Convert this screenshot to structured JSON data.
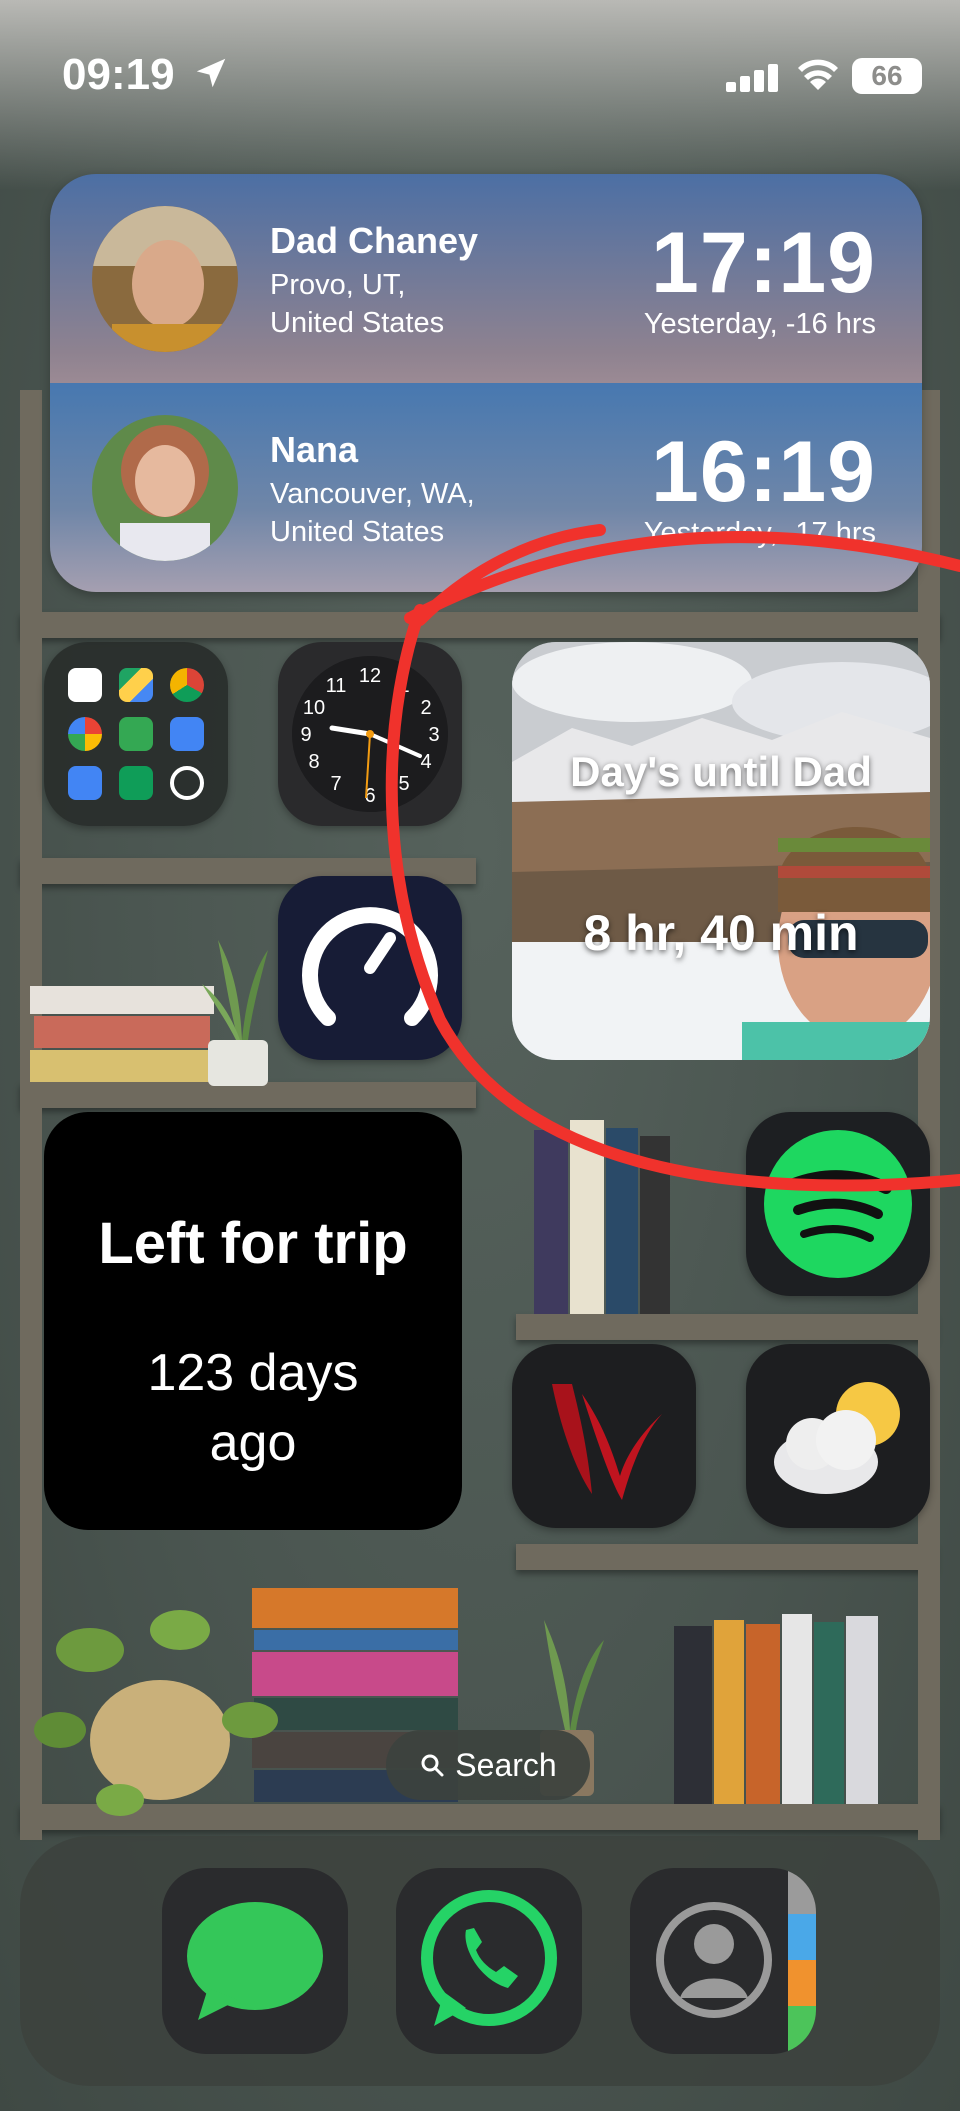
{
  "status_bar": {
    "time": "09:19",
    "battery": "66"
  },
  "world_clock": {
    "entries": [
      {
        "name": "Dad Chaney",
        "location": "Provo, UT,\nUnited States",
        "time": "17:19",
        "relative": "Yesterday, -16 hrs"
      },
      {
        "name": "Nana",
        "location": "Vancouver, WA,\nUnited States",
        "time": "16:19",
        "relative": "Yesterday, -17 hrs"
      }
    ]
  },
  "apps": {
    "folder": [
      "Gmail",
      "Google Drive",
      "Chrome",
      "Google Photos",
      "Google Maps",
      "Google Translate",
      "Google Docs",
      "Google Sheets",
      "Google One"
    ],
    "clock_numbers": [
      "12",
      "1",
      "2",
      "3",
      "4",
      "5",
      "6",
      "7",
      "8",
      "9",
      "10",
      "11"
    ],
    "speedtest": "Speedtest",
    "spotify": "Spotify",
    "red_app": "App",
    "weather": "Weather"
  },
  "countdown_widget": {
    "title": "Day's until Dad",
    "value": "8 hr, 40 min"
  },
  "trip_widget": {
    "title": "Left for trip",
    "value": "123 days\nago"
  },
  "search": {
    "label": "Search"
  },
  "dock": {
    "apps": [
      "Messages",
      "WhatsApp",
      "Contacts"
    ]
  },
  "colors": {
    "annotation": "#f0322c",
    "spotify_green": "#1ed760",
    "messages_green": "#34c759"
  }
}
